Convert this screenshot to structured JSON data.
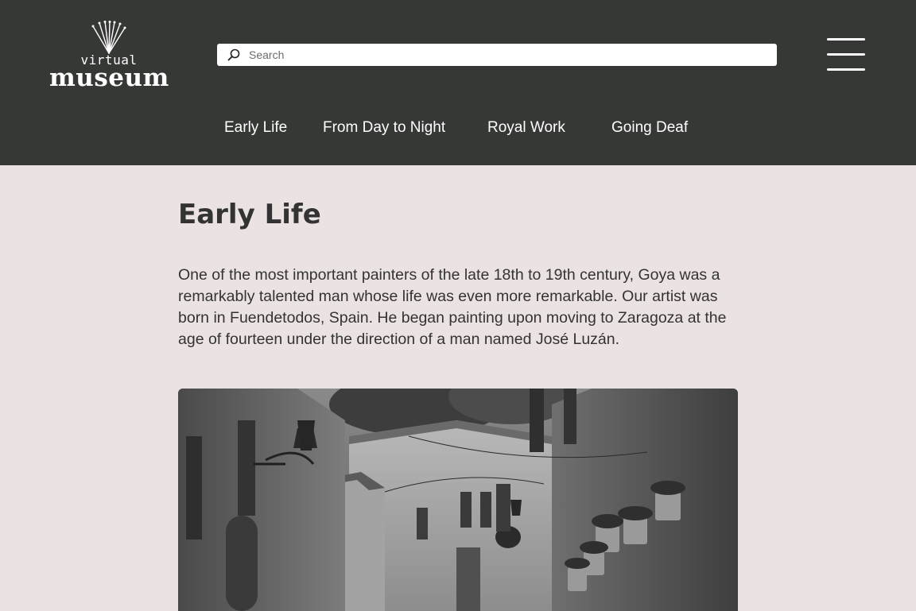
{
  "logo": {
    "top_text": "virtual",
    "bottom_text": "museum"
  },
  "search": {
    "placeholder": "Search"
  },
  "nav": {
    "items": [
      {
        "label": "Early Life"
      },
      {
        "label": "From Day to Night"
      },
      {
        "label": "Royal Work"
      },
      {
        "label": "Going Deaf"
      }
    ]
  },
  "main": {
    "title": "Early Life",
    "paragraph": "One of the most important painters of the late 18th to 19th century, Goya was a remarkably talented man whose life was even more remarkable. Our artist was born in Fuendetodos, Spain. He began painting upon moving to Zaragoza at the age of fourteen under the direction of a man named José Luzán."
  },
  "colors": {
    "header_bg": "#363836",
    "page_bg": "#ebe3e1",
    "text": "#333333"
  },
  "icons": {
    "search": "search-icon",
    "menu": "hamburger-menu-icon"
  }
}
